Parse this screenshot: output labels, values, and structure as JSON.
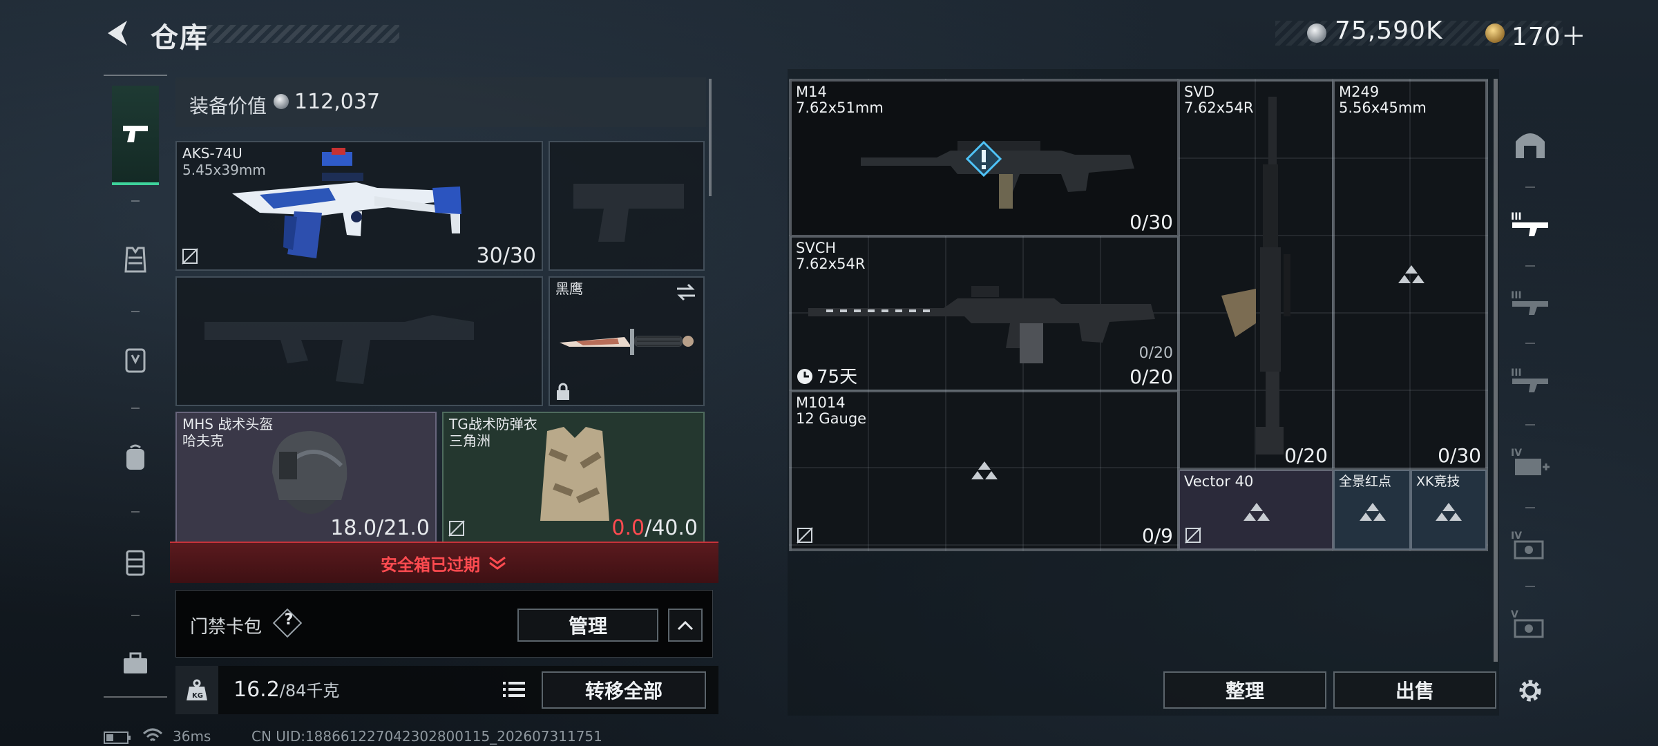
{
  "header": {
    "title": "仓库",
    "currency_primary": "75,590K",
    "currency_secondary": "170＋"
  },
  "loadout": {
    "value_label": "装备价值",
    "value_amount": "112,037",
    "primary_weapon": {
      "name": "AKS-74U",
      "caliber": "5.45x39mm",
      "ammo": "30/30"
    },
    "melee": {
      "name": "黑鹰"
    },
    "helmet": {
      "name": "MHS 战术头盔",
      "sub": "哈夫克",
      "durability": "18.0/21.0"
    },
    "armor": {
      "name": "TG战术防弹衣",
      "sub": "三角洲",
      "durability_current": "0.0",
      "durability_max": "/40.0"
    },
    "safebox_status": "安全箱已过期",
    "keycard_label": "门禁卡包",
    "keycard_help": "?",
    "manage_label": "管理",
    "weight_current": "16.2",
    "weight_max": "/84千克",
    "transfer_all_label": "转移全部"
  },
  "stash": {
    "items": [
      {
        "name": "M14",
        "caliber": "7.62x51mm",
        "count": "0/30"
      },
      {
        "name": "SVD",
        "caliber": "7.62x54R",
        "count": "0/20"
      },
      {
        "name": "M249",
        "caliber": "5.56x45mm",
        "count": "0/30"
      },
      {
        "name": "SVCH",
        "caliber": "7.62x54R",
        "count": "0/20",
        "count_secondary": "0/20",
        "timer": "75天"
      },
      {
        "name": "M1014",
        "caliber": "12 Gauge",
        "count": "0/9"
      },
      {
        "name": "Vector 40"
      },
      {
        "name": "全景红点"
      },
      {
        "name": "XK竞技"
      }
    ],
    "sort_label": "整理",
    "sell_label": "出售"
  },
  "status_bar": {
    "ping": "36ms",
    "uid": "CN UID:188661227042302800115_202607311751"
  },
  "colors": {
    "accent_green": "#3ed39b",
    "warning_red": "#ff4b50",
    "helmet_bg": "#3a3848",
    "armor_bg": "#24372f"
  },
  "icons": {
    "categories": [
      "pistol-icon",
      "vest-icon",
      "backpack-armor-icon",
      "backpack-icon",
      "chest-rig-icon",
      "toolbox-icon"
    ],
    "side_tabs": [
      "stash-home-icon",
      "sniper-tab-icon",
      "rifle-tab-3-icon",
      "rifle-tab-3b-icon",
      "medkit-tab-4-icon",
      "case-tab-4-icon",
      "case-tab-5-icon",
      "settings-icon"
    ]
  }
}
